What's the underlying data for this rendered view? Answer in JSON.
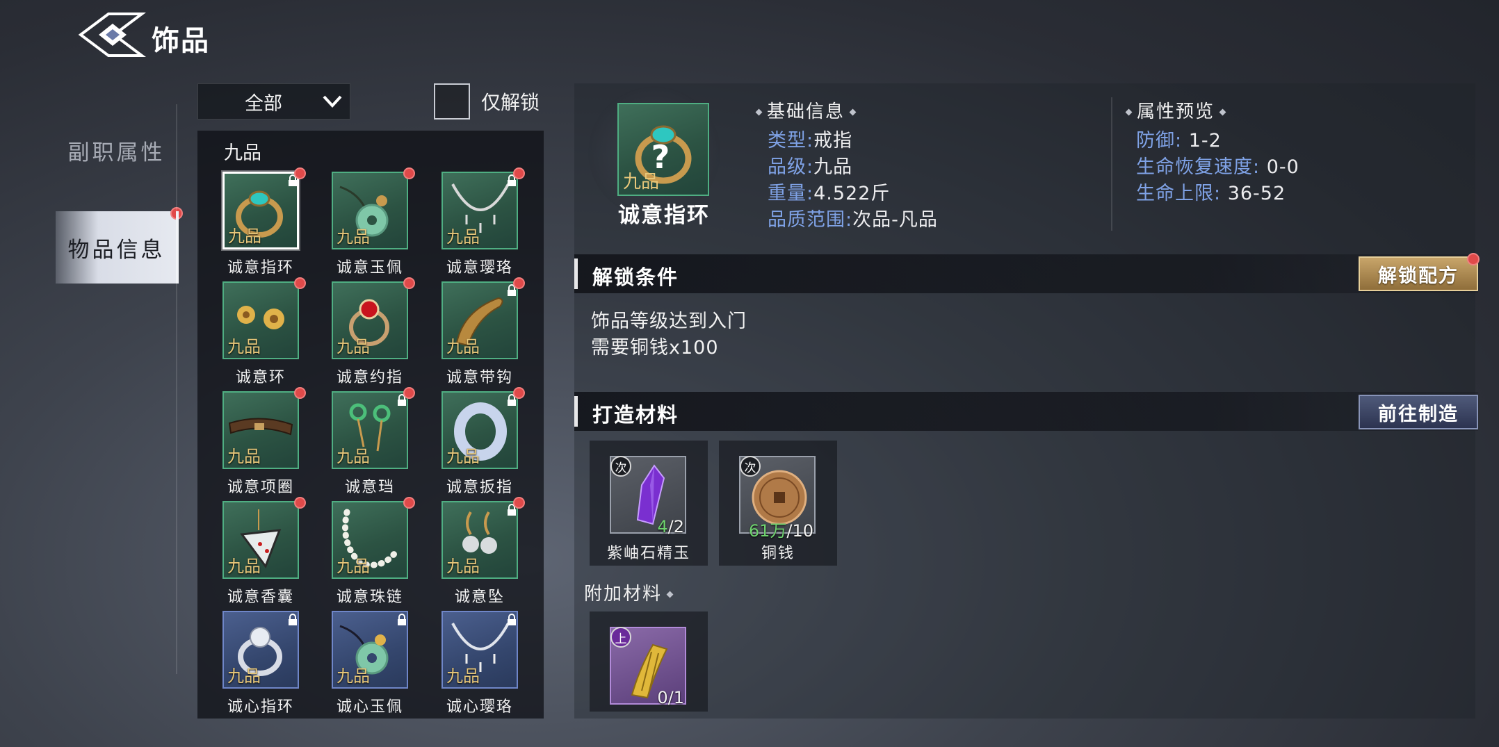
{
  "header": {
    "title": "饰品"
  },
  "side_tabs": [
    {
      "label": "副职属性",
      "active": false
    },
    {
      "label": "物品信息",
      "active": true
    }
  ],
  "filter": {
    "dropdown_value": "全部",
    "checkbox_label": "仅解锁"
  },
  "list": {
    "grade_heading": "九品",
    "items": [
      {
        "name": "诚意指环",
        "grade": "九品",
        "locked": true,
        "icon": "ring-icon"
      },
      {
        "name": "诚意玉佩",
        "grade": "九品",
        "locked": false,
        "icon": "jade-pendant-icon"
      },
      {
        "name": "诚意璎珞",
        "grade": "九品",
        "locked": true,
        "icon": "necklace-icon"
      },
      {
        "name": "诚意环",
        "grade": "九品",
        "locked": false,
        "icon": "earrings-icon"
      },
      {
        "name": "诚意约指",
        "grade": "九品",
        "locked": false,
        "icon": "ruby-ring-icon"
      },
      {
        "name": "诚意带钩",
        "grade": "九品",
        "locked": true,
        "icon": "belt-hook-icon"
      },
      {
        "name": "诚意项圈",
        "grade": "九品",
        "locked": false,
        "icon": "collar-icon"
      },
      {
        "name": "诚意珰",
        "grade": "九品",
        "locked": true,
        "icon": "drop-earrings-icon"
      },
      {
        "name": "诚意扳指",
        "grade": "九品",
        "locked": true,
        "icon": "thumb-ring-icon"
      },
      {
        "name": "诚意香囊",
        "grade": "九品",
        "locked": false,
        "icon": "sachet-icon"
      },
      {
        "name": "诚意珠链",
        "grade": "九品",
        "locked": false,
        "icon": "pearl-chain-icon"
      },
      {
        "name": "诚意坠",
        "grade": "九品",
        "locked": true,
        "icon": "pendant-earring-icon"
      },
      {
        "name": "诚心指环",
        "grade": "九品",
        "locked": true,
        "icon": "silver-ring-icon"
      },
      {
        "name": "诚心玉佩",
        "grade": "九品",
        "locked": true,
        "icon": "jade-pendant-icon"
      },
      {
        "name": "诚心璎珞",
        "grade": "九品",
        "locked": true,
        "icon": "necklace-icon"
      }
    ]
  },
  "detail": {
    "name": "诚意指环",
    "grade": "九品",
    "basic_info_title": "基础信息",
    "basic_info": [
      {
        "key": "类型",
        "value": "戒指"
      },
      {
        "key": "品级",
        "value": "九品"
      },
      {
        "key": "重量",
        "value": "4.522斤"
      },
      {
        "key": "品质范围",
        "value": "次品-凡品"
      }
    ],
    "attr_title": "属性预览",
    "attrs": [
      {
        "key": "防御",
        "value": "1-2"
      },
      {
        "key": "生命恢复速度",
        "value": "0-0"
      },
      {
        "key": "生命上限",
        "value": "36-52"
      }
    ],
    "unlock": {
      "title": "解锁条件",
      "button": "解锁配方",
      "conditions": [
        "饰品等级达到入门",
        "需要铜钱x100"
      ]
    },
    "materials": {
      "title": "打造材料",
      "button": "前往制造",
      "items": [
        {
          "name": "紫岫石精玉",
          "quality": "次",
          "have": "4",
          "need": "/2"
        },
        {
          "name": "铜钱",
          "quality": "次",
          "have": "61万",
          "need": "/10"
        }
      ]
    },
    "extra": {
      "title": "附加材料",
      "items": [
        {
          "quality": "上",
          "count": "0/1"
        }
      ]
    }
  },
  "colors": {
    "accent_gold": "#c8a56a",
    "key_blue": "#7fa2e6",
    "alert_red": "#e04a4a",
    "grade_green": "#4fae82",
    "grade_blue": "#6f86c8"
  }
}
